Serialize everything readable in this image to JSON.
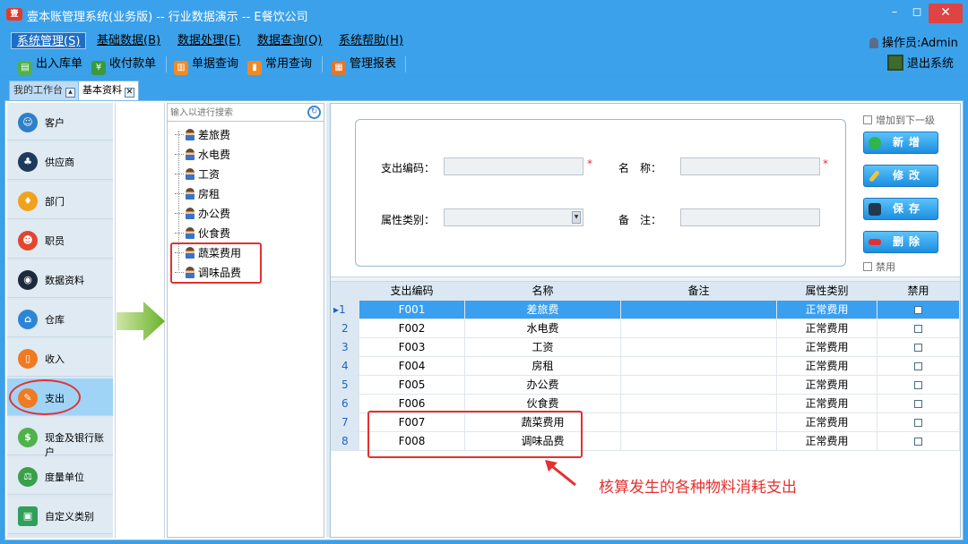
{
  "window": {
    "title": "壹本账管理系统(业务版) -- 行业数据演示 -- E餐饮公司",
    "logo": "壹",
    "min": "–",
    "max": "◻",
    "close": "✕"
  },
  "menu": [
    "系统管理(S)",
    "基础数据(B)",
    "数据处理(E)",
    "数据查询(Q)",
    "系统帮助(H)"
  ],
  "operator": "操作员:Admin",
  "toolbar": [
    "出入库单",
    "收付款单",
    "单据查询",
    "常用查询",
    "管理报表"
  ],
  "exit": "退出系统",
  "tabs": [
    "我的工作台",
    "基本资料"
  ],
  "sidebar": [
    "客户",
    "供应商",
    "部门",
    "职员",
    "数据资料",
    "仓库",
    "收入",
    "支出",
    "现金及银行账户",
    "度量单位",
    "自定义类别"
  ],
  "search": {
    "placeholder": "输入以进行搜索"
  },
  "tree": [
    "差旅费",
    "水电费",
    "工资",
    "房租",
    "办公费",
    "伙食费",
    "蔬菜费用",
    "调味品费"
  ],
  "form": {
    "code_label": "支出编码：",
    "name_label": "名　称：",
    "type_label": "属性类别：",
    "note_label": "备　注：",
    "star": "*",
    "add_next": "增加到下一级",
    "disable": "禁用"
  },
  "buttons": [
    "新增",
    "修改",
    "保存",
    "删除"
  ],
  "grid": {
    "headers": [
      "支出编码",
      "名称",
      "备注",
      "属性类别",
      "禁用"
    ],
    "rows": [
      {
        "n": "1",
        "code": "F001",
        "name": "差旅费",
        "note": "",
        "type": "正常费用"
      },
      {
        "n": "2",
        "code": "F002",
        "name": "水电费",
        "note": "",
        "type": "正常费用"
      },
      {
        "n": "3",
        "code": "F003",
        "name": "工资",
        "note": "",
        "type": "正常费用"
      },
      {
        "n": "4",
        "code": "F004",
        "name": "房租",
        "note": "",
        "type": "正常费用"
      },
      {
        "n": "5",
        "code": "F005",
        "name": "办公费",
        "note": "",
        "type": "正常费用"
      },
      {
        "n": "6",
        "code": "F006",
        "name": "伙食费",
        "note": "",
        "type": "正常费用"
      },
      {
        "n": "7",
        "code": "F007",
        "name": "蔬菜费用",
        "note": "",
        "type": "正常费用"
      },
      {
        "n": "8",
        "code": "F008",
        "name": "调味品费",
        "note": "",
        "type": "正常费用"
      }
    ]
  },
  "annotation": "核算发生的各种物料消耗支出",
  "colors": {
    "titlebar": "#3ba1ea",
    "selected_row": "#3b9ff0",
    "annotation": "#e53030"
  }
}
